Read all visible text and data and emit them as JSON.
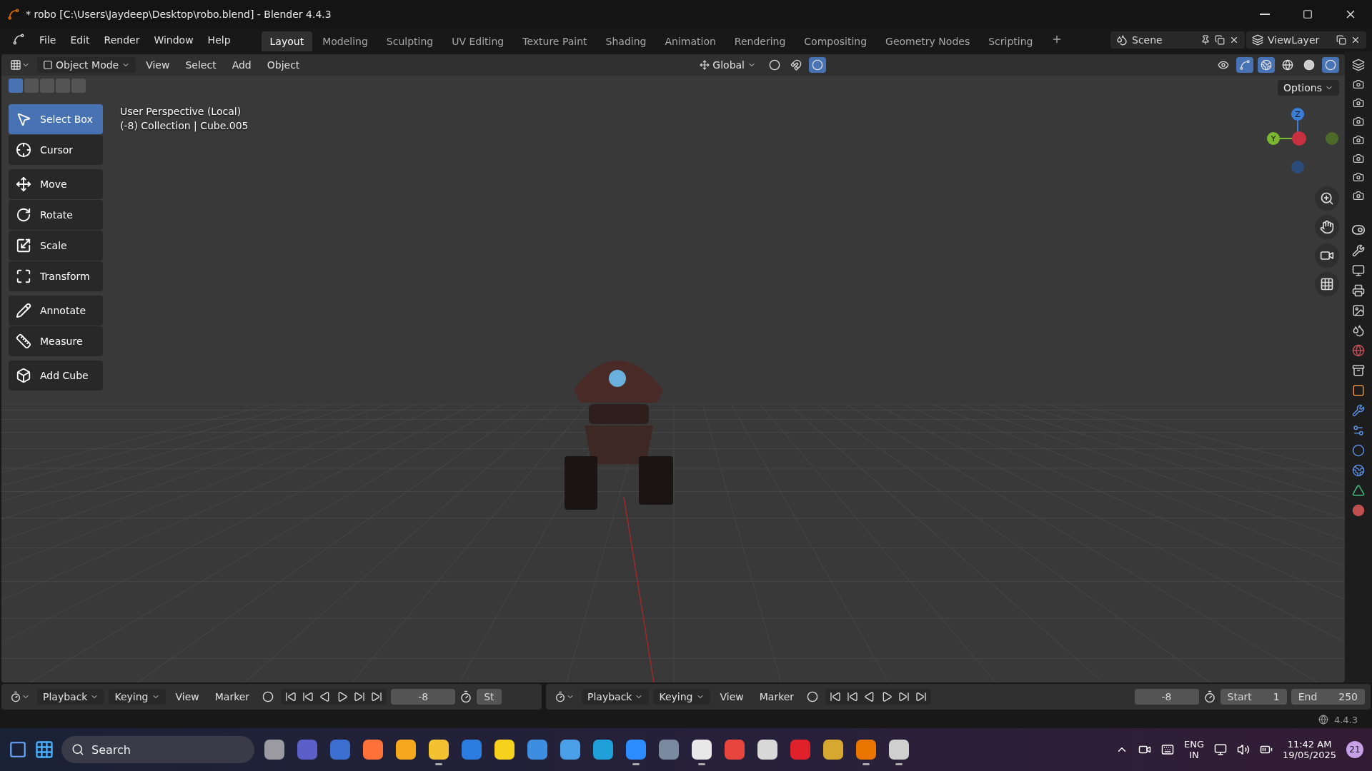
{
  "title_bar": {
    "title": "* robo [C:\\Users\\Jaydeep\\Desktop\\robo.blend] - Blender 4.4.3"
  },
  "menu": [
    "File",
    "Edit",
    "Render",
    "Window",
    "Help"
  ],
  "workspaces": [
    {
      "label": "Layout",
      "selected": true
    },
    {
      "label": "Modeling",
      "selected": false
    },
    {
      "label": "Sculpting",
      "selected": false
    },
    {
      "label": "UV Editing",
      "selected": false
    },
    {
      "label": "Texture Paint",
      "selected": false
    },
    {
      "label": "Shading",
      "selected": false
    },
    {
      "label": "Animation",
      "selected": false
    },
    {
      "label": "Rendering",
      "selected": false
    },
    {
      "label": "Compositing",
      "selected": false
    },
    {
      "label": "Geometry Nodes",
      "selected": false
    },
    {
      "label": "Scripting",
      "selected": false
    }
  ],
  "scene": "Scene",
  "view_layer": "ViewLayer",
  "header": {
    "mode": "Object Mode",
    "menus": [
      "View",
      "Select",
      "Add",
      "Object"
    ],
    "orientation": "Global",
    "options": "Options"
  },
  "overlay_text": [
    "User Perspective (Local)",
    "(-8) Collection | Cube.005"
  ],
  "tool_groups": [
    {
      "tools": [
        {
          "label": "Select Box",
          "kind": "select",
          "selected": true
        },
        {
          "label": "Cursor",
          "kind": "cursor",
          "selected": false
        }
      ]
    },
    {
      "tools": [
        {
          "label": "Move",
          "kind": "move",
          "selected": false
        },
        {
          "label": "Rotate",
          "kind": "rotate",
          "selected": false
        },
        {
          "label": "Scale",
          "kind": "scale",
          "selected": false
        },
        {
          "label": "Transform",
          "kind": "transform",
          "selected": false
        }
      ]
    },
    {
      "tools": [
        {
          "label": "Annotate",
          "kind": "annotate",
          "selected": false
        },
        {
          "label": "Measure",
          "kind": "measure",
          "selected": false
        }
      ]
    },
    {
      "tools": [
        {
          "label": "Add Cube",
          "kind": "add_cube",
          "selected": false
        }
      ]
    }
  ],
  "gizmo": {
    "z": "Z",
    "y": "Y"
  },
  "timelines": [
    {
      "menus": [
        "Playback",
        "Keying",
        "View",
        "Marker"
      ],
      "frame": "-8",
      "start_label": "St"
    },
    {
      "menus": [
        "Playback",
        "Keying",
        "View",
        "Marker"
      ],
      "frame": "-8",
      "start_label": "Start",
      "start": "1",
      "end_label": "End",
      "end": "250"
    }
  ],
  "status_bar": {
    "version": "4.4.3"
  },
  "taskbar": {
    "search": "Search",
    "apps": [
      {
        "color": "#9a9aa0",
        "running": false
      },
      {
        "color": "#5b5fc7",
        "running": false
      },
      {
        "color": "#3b6fd0",
        "running": false
      },
      {
        "color": "#ff7139",
        "running": false
      },
      {
        "color": "#f6a81c",
        "running": false
      },
      {
        "color": "#f2c230",
        "running": true
      },
      {
        "color": "#2b7de0",
        "running": false
      },
      {
        "color": "#f7d21c",
        "running": false
      },
      {
        "color": "#3d8de0",
        "running": false
      },
      {
        "color": "#4aa0e8",
        "running": false
      },
      {
        "color": "#1fa0d8",
        "running": false
      },
      {
        "color": "#2d8cff",
        "running": true
      },
      {
        "color": "#7a8aa0",
        "running": false
      },
      {
        "color": "#e8e8e8",
        "running": true
      },
      {
        "color": "#e8453c",
        "running": false
      },
      {
        "color": "#d8d8d8",
        "running": false
      },
      {
        "color": "#e0202a",
        "running": false
      },
      {
        "color": "#d6a830",
        "running": false
      },
      {
        "color": "#ea7600",
        "running": true
      },
      {
        "color": "#cfcfcf",
        "running": true
      }
    ],
    "language": "ENG",
    "region": "IN",
    "time": "11:42 AM",
    "date": "19/05/2025",
    "badge": "21"
  }
}
